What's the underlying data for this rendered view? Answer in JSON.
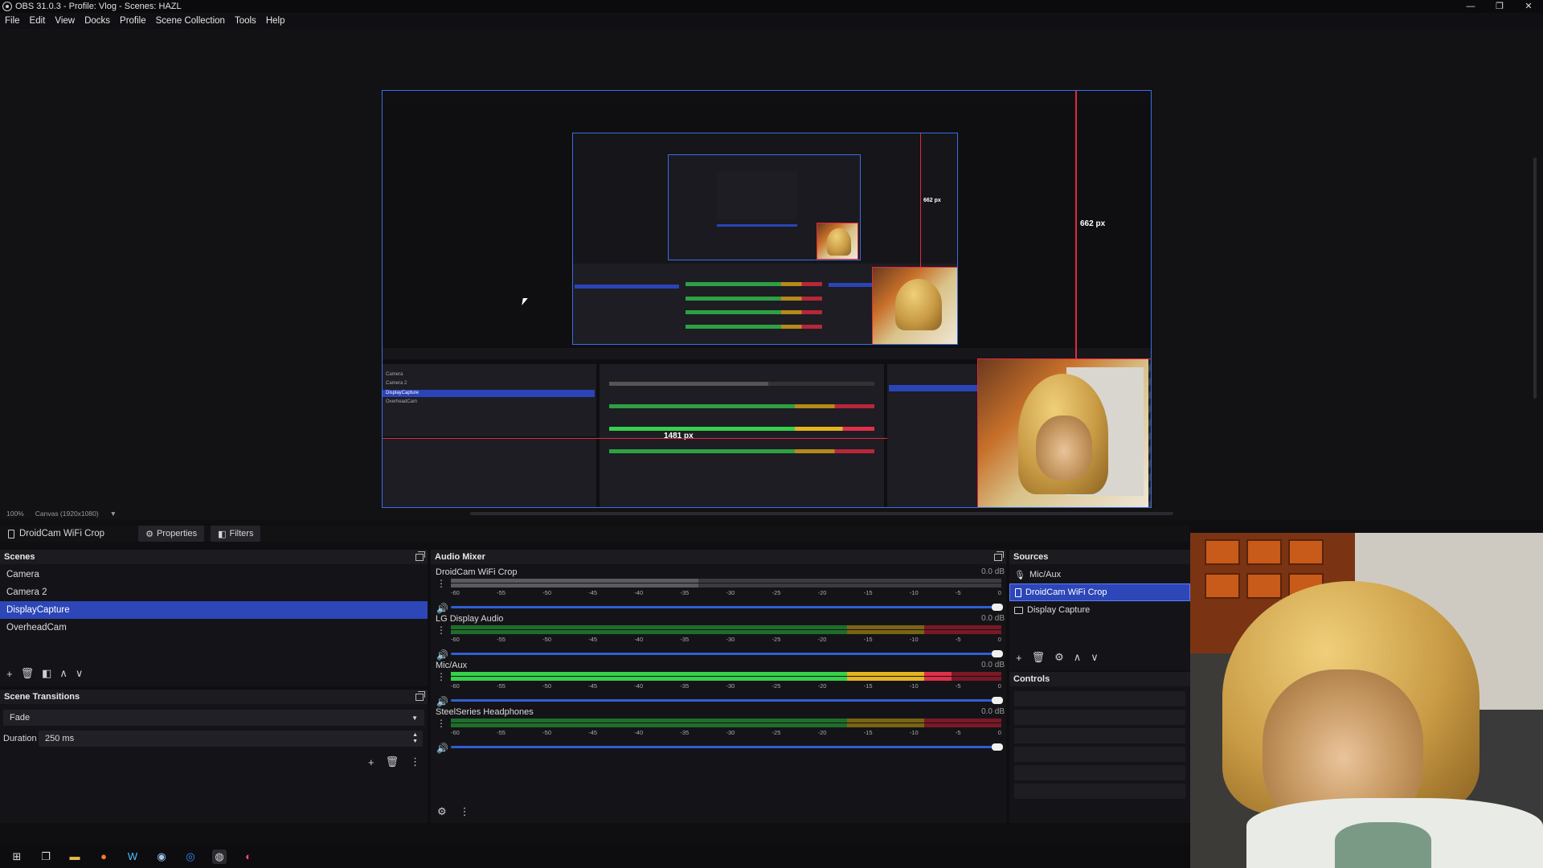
{
  "window": {
    "title": "OBS 31.0.3 - Profile: Vlog - Scenes: HAZL",
    "controls": {
      "minimize": "—",
      "maximize": "❐",
      "close": "✕"
    }
  },
  "menu": [
    "File",
    "Edit",
    "View",
    "Docks",
    "Profile",
    "Scene Collection",
    "Tools",
    "Help"
  ],
  "preview": {
    "zoom": "100%",
    "canvas_label": "Canvas (1920x1080)",
    "height_label": "662 px",
    "width_label": "1481 px",
    "nested_height_label": "662 px"
  },
  "source_toolbar": {
    "source_name": "DroidCam WiFi Crop",
    "properties_label": "Properties",
    "filters_label": "Filters"
  },
  "scenes": {
    "title": "Scenes",
    "items": [
      "Camera",
      "Camera 2",
      "DisplayCapture",
      "OverheadCam"
    ],
    "active_index": 2,
    "tools": [
      "+",
      "🗑",
      "◧",
      "∧",
      "∨"
    ]
  },
  "transitions": {
    "title": "Scene Transitions",
    "type": "Fade",
    "duration_label": "Duration",
    "duration_value": "250 ms"
  },
  "mixer": {
    "title": "Audio Mixer",
    "scale": [
      "-60",
      "-55",
      "-50",
      "-45",
      "-40",
      "-35",
      "-30",
      "-25",
      "-20",
      "-15",
      "-10",
      "-5",
      "0"
    ],
    "channels": [
      {
        "name": "DroidCam WiFi Crop",
        "db": "0.0 dB",
        "level": 0.45,
        "muted": true
      },
      {
        "name": "LG Display Audio",
        "db": "0.0 dB",
        "level": 0.0,
        "muted": false
      },
      {
        "name": "Mic/Aux",
        "db": "0.0 dB",
        "level": 0.91,
        "muted": false
      },
      {
        "name": "SteelSeries Headphones",
        "db": "0.0 dB",
        "level": 0.0,
        "muted": false
      }
    ]
  },
  "sources": {
    "title": "Sources",
    "items": [
      {
        "name": "Mic/Aux",
        "icon": "microphone-icon"
      },
      {
        "name": "DroidCam WiFi Crop",
        "icon": "video-source-icon"
      },
      {
        "name": "Display Capture",
        "icon": "monitor-icon"
      }
    ],
    "active_index": 1
  },
  "controls": {
    "title": "Controls"
  },
  "colors": {
    "accent": "#2d46b8",
    "selection_border": "#3a6fe0",
    "guide_red": "#e02a3a",
    "meter_green": "#36d14b",
    "meter_yellow": "#e3b51f",
    "meter_red": "#e0304a"
  },
  "taskbar_icons": [
    "windows-start-icon",
    "task-view-icon",
    "file-explorer-icon",
    "firefox-icon",
    "app-w-icon",
    "steam-icon",
    "browser-icon",
    "obs-icon",
    "app-red-icon"
  ]
}
